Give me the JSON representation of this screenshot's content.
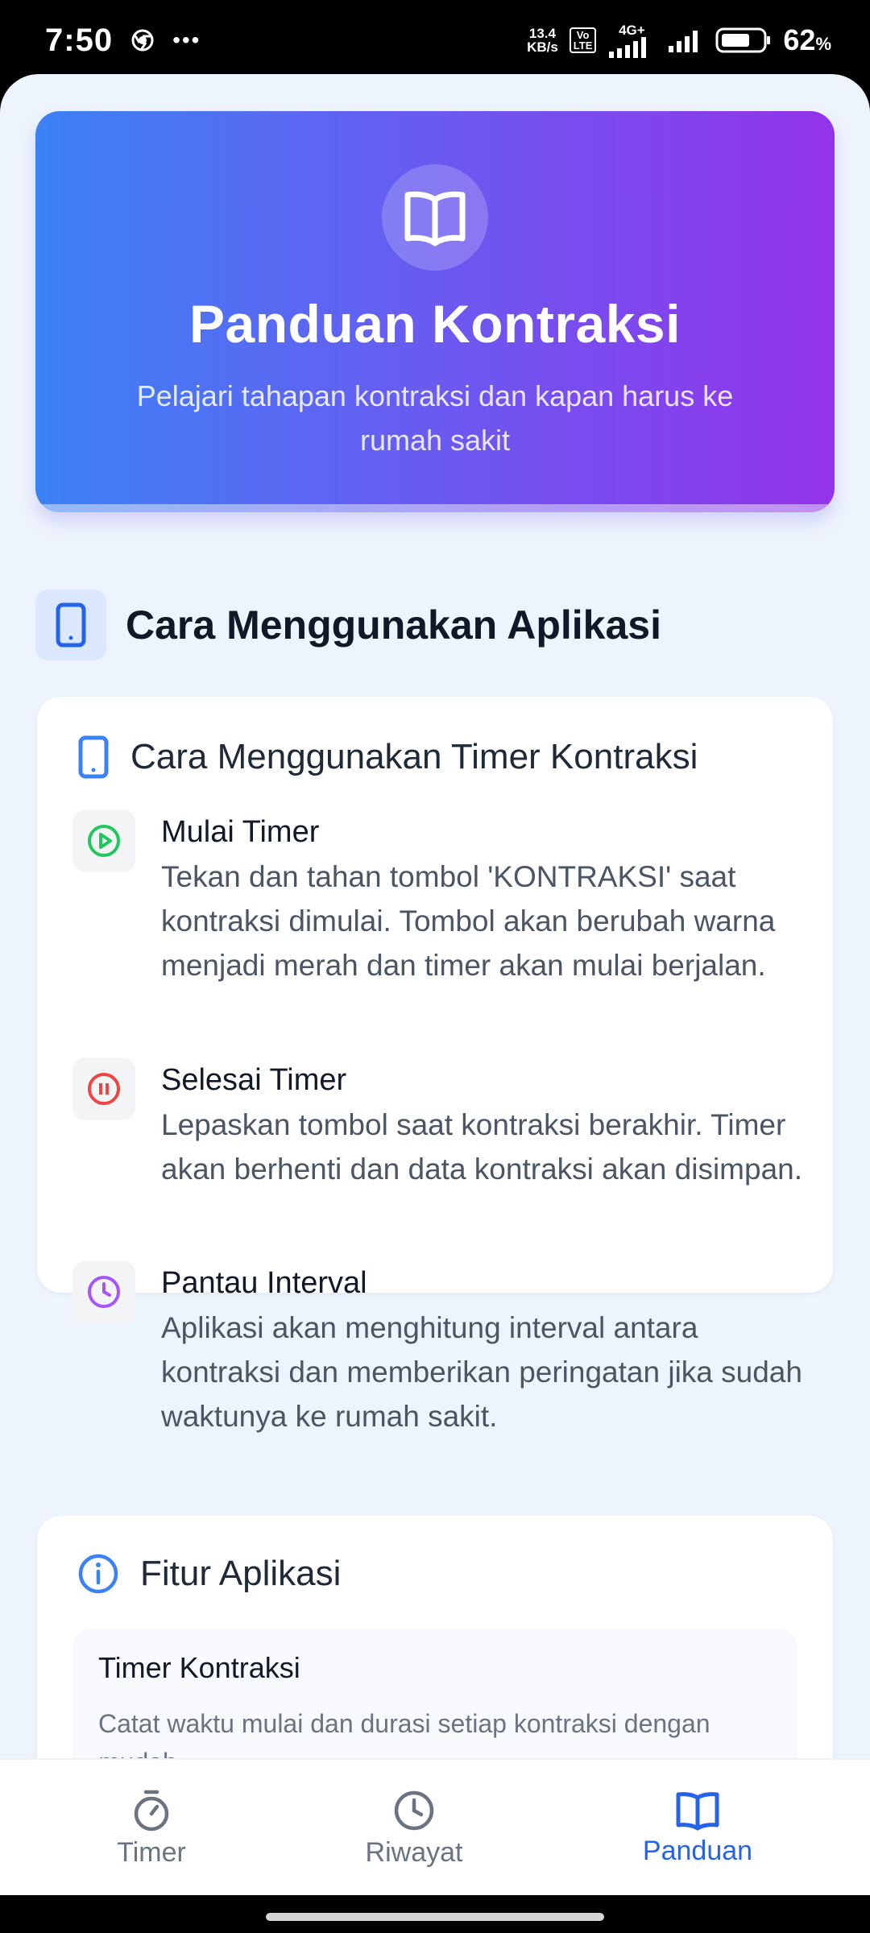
{
  "status_bar": {
    "time": "7:50",
    "more": "•••",
    "net_speed_value": "13.4",
    "net_speed_unit": "KB/s",
    "volte_top": "Vo",
    "volte_bottom": "LTE",
    "network": "4G+",
    "battery_percent": "62",
    "battery_unit": "%"
  },
  "hero": {
    "title": "Panduan Kontraksi",
    "subtitle": "Pelajari tahapan kontraksi dan kapan harus ke rumah sakit"
  },
  "usage_section": {
    "title": "Cara Menggunakan Aplikasi",
    "card_title": "Cara Menggunakan Timer Kontraksi",
    "steps": [
      {
        "title": "Mulai Timer",
        "desc": "Tekan dan tahan tombol 'KONTRAKSI' saat kontraksi dimulai. Tombol akan berubah warna menjadi merah dan timer akan mulai berjalan.",
        "icon": "play-circle-icon",
        "color": "#22c55e"
      },
      {
        "title": "Selesai Timer",
        "desc": "Lepaskan tombol saat kontraksi berakhir. Timer akan berhenti dan data kontraksi akan disimpan.",
        "icon": "pause-circle-icon",
        "color": "#ef4444"
      },
      {
        "title": "Pantau Interval",
        "desc": "Aplikasi akan menghitung interval antara kontraksi dan memberikan peringatan jika sudah waktunya ke rumah sakit.",
        "icon": "clock-icon",
        "color": "#a855f7"
      }
    ]
  },
  "features_card": {
    "title": "Fitur Aplikasi",
    "items": [
      {
        "title": "Timer Kontraksi",
        "desc": "Catat waktu mulai dan durasi setiap kontraksi dengan mudah"
      }
    ]
  },
  "bottom_nav": {
    "items": [
      {
        "label": "Timer",
        "icon": "stopwatch-icon",
        "active": false
      },
      {
        "label": "Riwayat",
        "icon": "clock-icon",
        "active": false
      },
      {
        "label": "Panduan",
        "icon": "book-open-icon",
        "active": true
      }
    ]
  },
  "colors": {
    "accent": "#2563eb",
    "hero_gradient_start": "#3b82f6",
    "hero_gradient_end": "#9333ea",
    "background": "#eef4fd"
  }
}
